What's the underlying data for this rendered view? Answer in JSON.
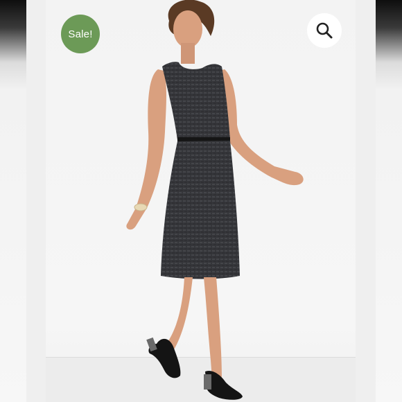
{
  "badge": {
    "label": "Sale!",
    "color": "#6c9a57"
  },
  "zoom_button": {
    "icon": "search-icon"
  },
  "product_image": {
    "alt": ""
  },
  "colors": {
    "dress": "#333436",
    "skin": "#d9a07f",
    "background": "#f3f3f3"
  }
}
